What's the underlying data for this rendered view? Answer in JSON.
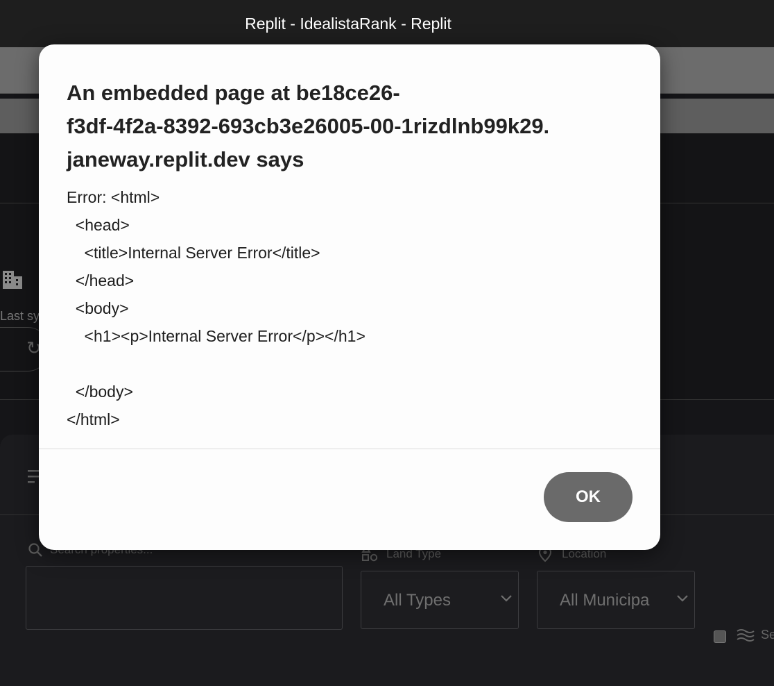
{
  "window": {
    "title": "Replit - IdealistaRank - Replit"
  },
  "background_app": {
    "last_sync_label": "Last sy",
    "search": {
      "placeholder": "Search properties..."
    },
    "land_type": {
      "label": "Land Type",
      "selected": "All Types"
    },
    "location": {
      "label": "Location",
      "selected": "All Municipa"
    },
    "partial_label": "Se",
    "icons": [
      "building-icon",
      "refresh-icon",
      "filter-icon",
      "search-icon",
      "shapes-icon",
      "location-pin-icon",
      "chevron-down-icon",
      "waves-icon"
    ]
  },
  "dialog": {
    "heading": "An embedded page at be18ce26-f3df-4f2a-8392-693cb3e26005-00-1rizdlnb99k29.janeway.replit.dev says",
    "heading_lines": [
      "An embedded page at be18ce26-",
      "f3df-4f2a-8392-693cb3e26005-00-1rizdlnb99k29.",
      "janeway.replit.dev says"
    ],
    "message": "Error: <html>\n  <head>\n    <title>Internal Server Error</title>\n  </head>\n  <body>\n    <h1><p>Internal Server Error</p></h1>\n\n  </body>\n</html>",
    "ok_label": "OK"
  }
}
